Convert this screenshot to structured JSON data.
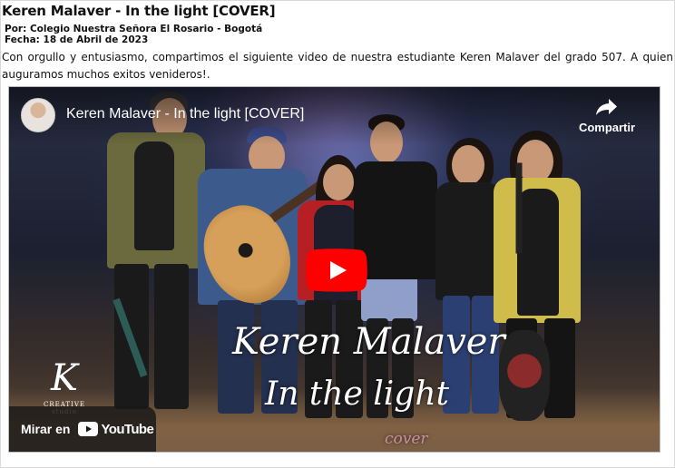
{
  "article": {
    "title": "Keren Malaver - In the light [COVER]",
    "author_line": "Por: Colegio Nuestra Señora El Rosario - Bogotá",
    "date_line": "Fecha: 18 de Abril de 2023",
    "body": "Con orgullo y entusiasmo, compartimos el siguiente video de nuestra estudiante Keren Malaver del grado 507. A quien auguramos muchos exitos venideros!."
  },
  "video": {
    "title": "Keren Malaver - In the light [COVER]",
    "share_label": "Compartir",
    "watch_on_label": "Mirar en",
    "youtube_label": "YouTube",
    "thumbnail_text": {
      "line1": "Keren Malaver",
      "line2": "In the light",
      "line3": "cover",
      "logo_letter": "K",
      "logo_caption": "CREATIVE studio"
    },
    "colors": {
      "youtube_red": "#ff0000",
      "overlay_bg": "#171717"
    }
  }
}
